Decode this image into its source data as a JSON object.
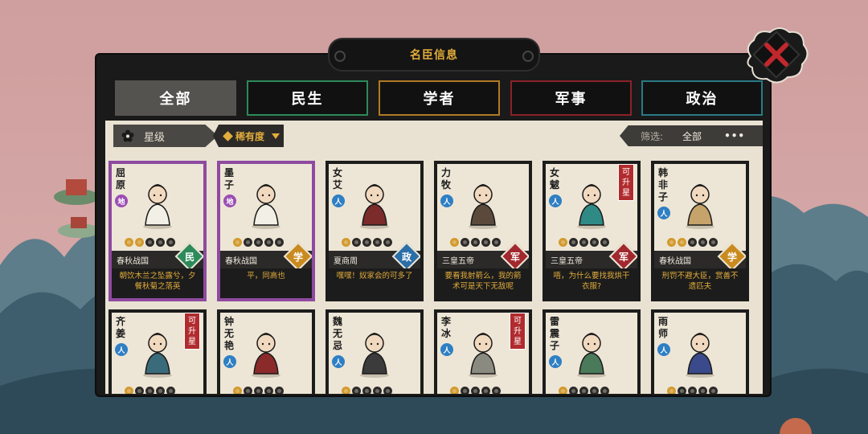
{
  "title": "名臣信息",
  "tabs": [
    "全部",
    "民生",
    "学者",
    "军事",
    "政治"
  ],
  "filters": {
    "star_label": "星级",
    "rarity_label": "稀有度",
    "filter_label": "筛选:",
    "filter_value": "全部",
    "more": "•••"
  },
  "colors": {
    "accent_gold": "#e2ad3b",
    "min": "#2d8a5a",
    "xue": "#c98a1e",
    "zheng": "#2b6ea8",
    "jun": "#a1282e",
    "rare_purple": "#8e4aa0"
  },
  "row1": [
    {
      "name": "屈原",
      "rank": "地",
      "stars": 2,
      "era": "春秋战国",
      "category": "民",
      "desc": "朝饮木兰之坠露兮，夕餐秋菊之落英"
    },
    {
      "name": "墨子",
      "rank": "地",
      "stars": 1,
      "era": "春秋战国",
      "category": "学",
      "desc": "平，同高也"
    },
    {
      "name": "女艾",
      "rank": "人",
      "stars": 1,
      "era": "夏商周",
      "category": "政",
      "desc": "嘿嘿！奴家会的可多了"
    },
    {
      "name": "力牧",
      "rank": "人",
      "stars": 1,
      "era": "三皇五帝",
      "category": "军",
      "desc": "要看我射箭么，我的箭术可是天下无敌呢"
    },
    {
      "name": "女魃",
      "rank": "人",
      "stars": 1,
      "era": "三皇五帝",
      "category": "军",
      "desc": "唔，为什么要找我烘干衣服?",
      "upgrade": "可升星"
    },
    {
      "name": "韩非子",
      "rank": "人",
      "stars": 2,
      "era": "春秋战国",
      "category": "学",
      "desc": "刑罚不避大臣，赏善不遗匹夫"
    }
  ],
  "row2": [
    {
      "name": "齐姜",
      "rank": "人",
      "stars": 1,
      "upgrade": "可升星"
    },
    {
      "name": "钟无艳",
      "rank": "人",
      "stars": 1
    },
    {
      "name": "魏无忌",
      "rank": "人",
      "stars": 1
    },
    {
      "name": "李冰",
      "rank": "人",
      "stars": 1,
      "upgrade": "可升星"
    },
    {
      "name": "雷震子",
      "rank": "人",
      "stars": 1
    },
    {
      "name": "雨师",
      "rank": "人",
      "stars": 1
    }
  ]
}
